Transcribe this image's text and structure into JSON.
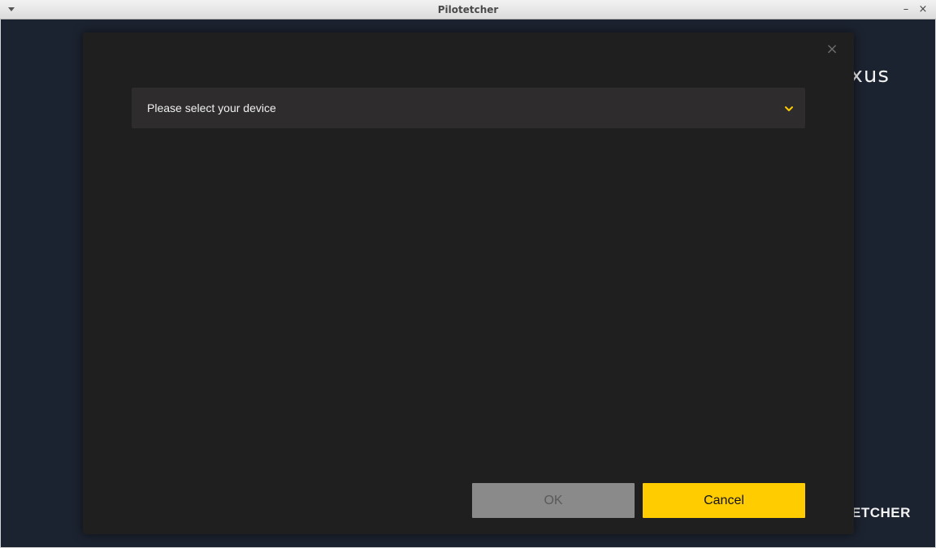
{
  "window": {
    "title": "Pilotetcher",
    "minimize_glyph": "–",
    "close_glyph": "×"
  },
  "background": {
    "brand_top_text": "exus",
    "brand_bottom_text": "ETCHER"
  },
  "modal": {
    "close_glyph": "×",
    "device_select": {
      "placeholder": "Please select your device",
      "chevron_icon": "chevron-down-icon"
    },
    "buttons": {
      "ok_label": "OK",
      "cancel_label": "Cancel"
    }
  },
  "colors": {
    "accent": "#ffcc00",
    "modal_bg": "#201f1f",
    "select_bg": "#2e2c2c",
    "app_bg": "#1c2330",
    "ok_disabled": "#8a8a8a"
  }
}
